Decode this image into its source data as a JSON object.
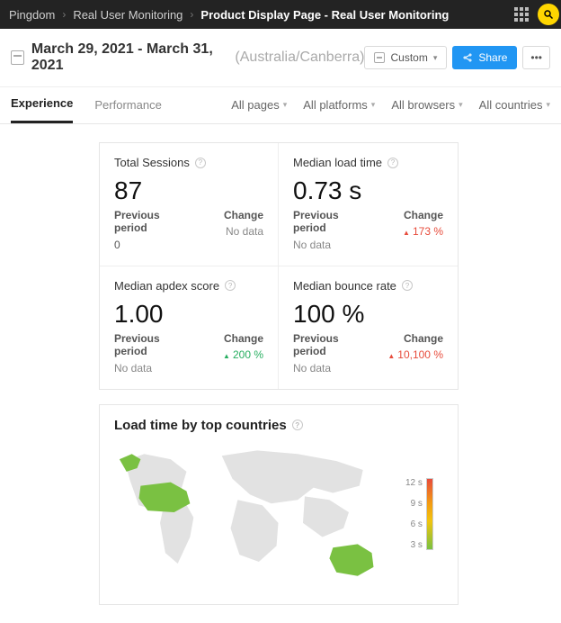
{
  "topbar": {
    "crumb1": "Pingdom",
    "crumb2": "Real User Monitoring",
    "crumb3": "Product Display Page - Real User Monitoring"
  },
  "toolbar": {
    "date_range": "March 29, 2021 - March 31, 2021",
    "timezone": "(Australia/Canberra)",
    "custom_label": "Custom",
    "share_label": "Share",
    "more_label": "•••"
  },
  "tabs": {
    "experience": "Experience",
    "performance": "Performance"
  },
  "filters": {
    "pages": "All pages",
    "platforms": "All platforms",
    "browsers": "All browsers",
    "countries": "All countries"
  },
  "cards": {
    "sessions": {
      "title": "Total Sessions",
      "value": "87",
      "prev_label": "Previous period",
      "prev_value": "0",
      "change_label": "Change",
      "change_value": "No data",
      "change_class": "nod"
    },
    "loadtime": {
      "title": "Median load time",
      "value": "0.73 s",
      "prev_label": "Previous period",
      "prev_value": "No data",
      "change_label": "Change",
      "change_value": "173 %",
      "change_dir": "▲",
      "change_class": "down"
    },
    "apdex": {
      "title": "Median apdex score",
      "value": "1.00",
      "prev_label": "Previous period",
      "prev_value": "No data",
      "change_label": "Change",
      "change_value": "200 %",
      "change_dir": "▲",
      "change_class": "up"
    },
    "bounce": {
      "title": "Median bounce rate",
      "value": "100 %",
      "prev_label": "Previous period",
      "prev_value": "No data",
      "change_label": "Change",
      "change_value": "10,100 %",
      "change_dir": "▲",
      "change_class": "down"
    }
  },
  "map_panel": {
    "title": "Load time by top countries",
    "legend": {
      "l1": "12 s",
      "l2": "9 s",
      "l3": "6 s",
      "l4": "3 s"
    }
  }
}
